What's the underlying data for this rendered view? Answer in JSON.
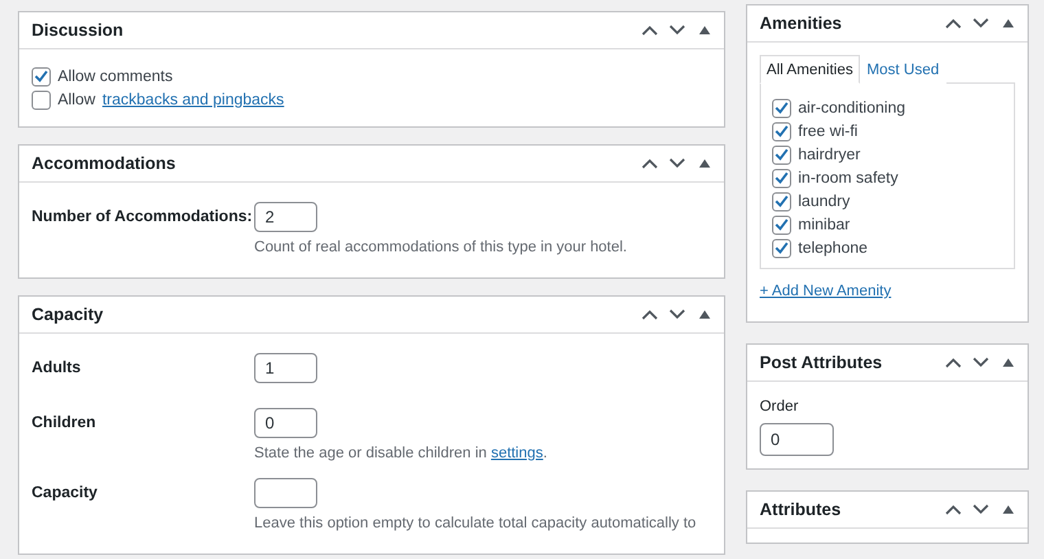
{
  "discussion": {
    "title": "Discussion",
    "options": [
      {
        "label": "Allow comments",
        "checked": true
      },
      {
        "label": "Allow",
        "link": "trackbacks and pingbacks",
        "checked": false
      }
    ]
  },
  "accommodations": {
    "title": "Accommodations",
    "fields": [
      {
        "label": "Number of Accommodations:",
        "value": "2",
        "hint": "Count of real accommodations of this type in your hotel."
      }
    ]
  },
  "capacity": {
    "title": "Capacity",
    "fields": [
      {
        "label": "Adults",
        "value": "1"
      },
      {
        "label": "Children",
        "value": "0",
        "hint": "State the age or disable children in ",
        "hint_link": "settings",
        "hint_after": "."
      },
      {
        "label": "Capacity",
        "hint": "Leave this option empty to calculate total capacity automatically to"
      }
    ]
  },
  "amenities": {
    "title": "Amenities",
    "tabs": [
      {
        "label": "All Amenities",
        "selected": true
      },
      {
        "label": "Most Used",
        "selected": false
      }
    ],
    "items": [
      {
        "label": "air-conditioning",
        "checked": true
      },
      {
        "label": "free wi-fi",
        "checked": true
      },
      {
        "label": "hairdryer",
        "checked": true
      },
      {
        "label": "in-room safety",
        "checked": true
      },
      {
        "label": "laundry",
        "checked": true
      },
      {
        "label": "minibar",
        "checked": true
      },
      {
        "label": "telephone",
        "checked": true
      }
    ],
    "add_link": "+ Add New Amenity"
  },
  "post_attributes": {
    "title": "Post Attributes",
    "label": "Order",
    "value": "0"
  },
  "attributes": {
    "title": "Attributes"
  }
}
